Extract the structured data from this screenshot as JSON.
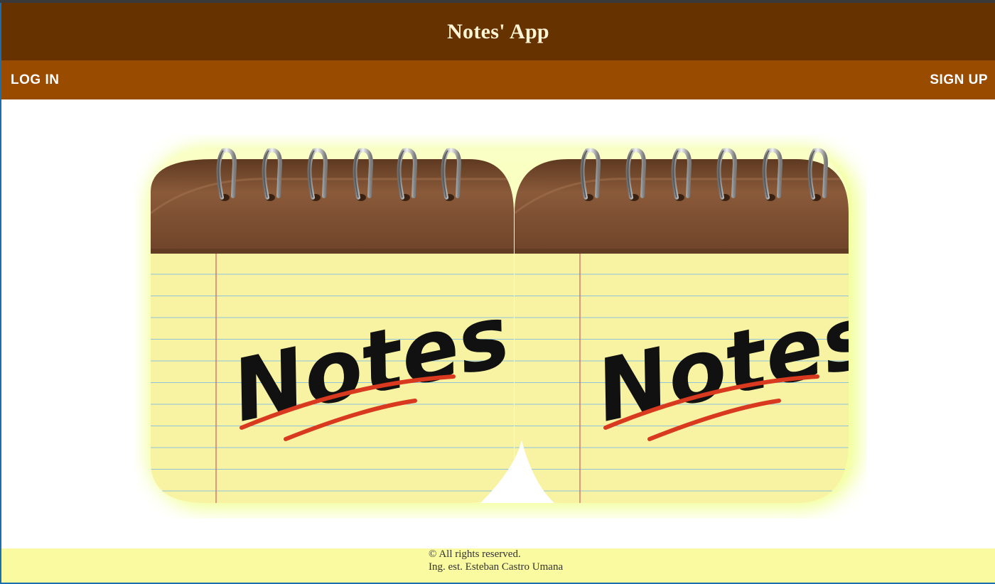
{
  "header": {
    "title": "Notes' App"
  },
  "nav": {
    "login_label": "LOG IN",
    "signup_label": "SIGN UP"
  },
  "hero": {
    "image_name": "notes-notepad-illustration",
    "notepad_text": "Notes",
    "notepad_count": 2,
    "colors": {
      "cover": "#7a4a2c",
      "paper": "#f7f3a3",
      "rule": "#8fc3d9",
      "margin_line": "#d06060",
      "underline": "#d9391e",
      "glow": "#f4ff8a"
    }
  },
  "footer": {
    "copyright": "© All rights reserved.",
    "author": "Ing. est. Esteban Castro Umana"
  },
  "colors": {
    "header_bg": "#663300",
    "nav_bg": "#994c00",
    "footer_bg": "#fafaa0",
    "title_text": "#fff5d6"
  }
}
